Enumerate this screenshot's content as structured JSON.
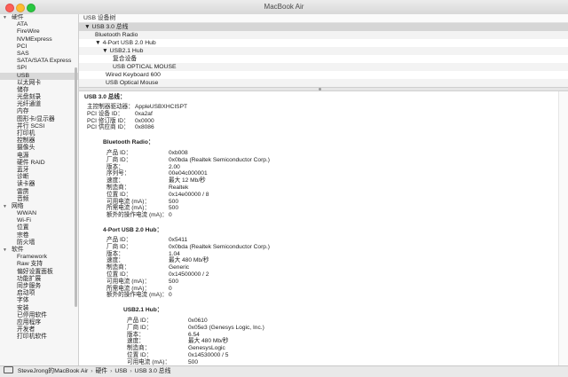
{
  "window": {
    "title": "MacBook Air"
  },
  "sidebar": {
    "categories": [
      {
        "label": "硬件",
        "items": [
          "ATA",
          "FireWire",
          "NVMExpress",
          "PCI",
          "SAS",
          "SATA/SATA Express",
          "SPI",
          "USB",
          "以太网卡",
          "储存",
          "光盘刻录",
          "光纤通道",
          "内存",
          "图形卡/显示器",
          "并行 SCSI",
          "打印机",
          "控制器",
          "摄像头",
          "电源",
          "硬件 RAID",
          "蓝牙",
          "诊断",
          "读卡器",
          "雷雳",
          "音频"
        ]
      },
      {
        "label": "网络",
        "items": [
          "WWAN",
          "Wi-Fi",
          "位置",
          "宗卷",
          "防火墙"
        ]
      },
      {
        "label": "软件",
        "items": [
          "Framework",
          "Raw 支持",
          "偏好设置面板",
          "功能扩展",
          "同步服务",
          "启动项",
          "字体",
          "安装",
          "已停用软件",
          "应用程序",
          "开发者",
          "打印机软件"
        ]
      }
    ],
    "selected": "USB"
  },
  "tree": {
    "header": "USB 设备树",
    "rows": [
      {
        "label": "USB 3.0 总线",
        "tri": "▼"
      },
      {
        "label": "Bluetooth Radio",
        "tri": ""
      },
      {
        "label": "4-Port USB 2.0 Hub",
        "tri": "▼"
      },
      {
        "label": "USB2.1 Hub",
        "tri": "▼"
      },
      {
        "label": "复合设备",
        "tri": ""
      },
      {
        "label": "USB OPTICAL MOUSE",
        "tri": ""
      },
      {
        "label": "Wired Keyboard 600",
        "tri": ""
      },
      {
        "label": "USB Optical Mouse",
        "tri": ""
      }
    ]
  },
  "detail": {
    "title": "USB 3.0 总线：",
    "bus": [
      {
        "k": "主控制器驱动器：",
        "v": "AppleUSBXHCISPT"
      },
      {
        "k": "PCI 设备 ID：",
        "v": "0xa2af"
      },
      {
        "k": "PCI 修订版 ID：",
        "v": "0x0000"
      },
      {
        "k": "PCI 供应商 ID：",
        "v": "0x8086"
      }
    ],
    "bluetooth": {
      "title": "Bluetooth Radio：",
      "fields": [
        {
          "k": "产品 ID：",
          "v": "0xb008"
        },
        {
          "k": "厂商 ID：",
          "v": "0x0bda  (Realtek Semiconductor Corp.)"
        },
        {
          "k": "版本：",
          "v": "2.00"
        },
        {
          "k": "序列号：",
          "v": "00e04c000001"
        },
        {
          "k": "速度：",
          "v": "最大 12 Mb/秒"
        },
        {
          "k": "制造商：",
          "v": "Realtek"
        },
        {
          "k": "位置 ID：",
          "v": "0x14e00000 / 8"
        },
        {
          "k": "可用电流 (mA)：",
          "v": "500"
        },
        {
          "k": "所需电流 (mA)：",
          "v": "500"
        },
        {
          "k": "额外的操作电流 (mA)：",
          "v": "0"
        }
      ]
    },
    "hub": {
      "title": "4-Port USB 2.0 Hub：",
      "fields": [
        {
          "k": "产品 ID：",
          "v": "0x5411"
        },
        {
          "k": "厂商 ID：",
          "v": "0x0bda  (Realtek Semiconductor Corp.)"
        },
        {
          "k": "版本：",
          "v": "1.04"
        },
        {
          "k": "速度：",
          "v": "最大 480 Mb/秒"
        },
        {
          "k": "制造商：",
          "v": "Generic"
        },
        {
          "k": "位置 ID：",
          "v": "0x14500000 / 2"
        },
        {
          "k": "可用电流 (mA)：",
          "v": "500"
        },
        {
          "k": "所需电流 (mA)：",
          "v": "0"
        },
        {
          "k": "额外的操作电流 (mA)：",
          "v": "0"
        }
      ]
    },
    "hub21": {
      "title": "USB2.1 Hub：",
      "fields": [
        {
          "k": "产品 ID：",
          "v": "0x0610"
        },
        {
          "k": "厂商 ID：",
          "v": "0x05e3  (Genesys Logic, Inc.)"
        },
        {
          "k": "版本：",
          "v": "6.54"
        },
        {
          "k": "速度：",
          "v": "最大 480 Mb/秒"
        },
        {
          "k": "制造商：",
          "v": "GenesysLogic"
        },
        {
          "k": "位置 ID：",
          "v": "0x14530000 / 5"
        },
        {
          "k": "可用电流 (mA)：",
          "v": "500"
        }
      ]
    }
  },
  "statusbar": {
    "path": [
      "SteveJrong的MacBook Air",
      "硬件",
      "USB",
      "USB 3.0 总线"
    ],
    "separator": "›"
  },
  "colors": {
    "close": "#fc5f57",
    "minimize": "#fdbc2e",
    "zoom": "#28c840",
    "selection": "#d9d9d9"
  }
}
